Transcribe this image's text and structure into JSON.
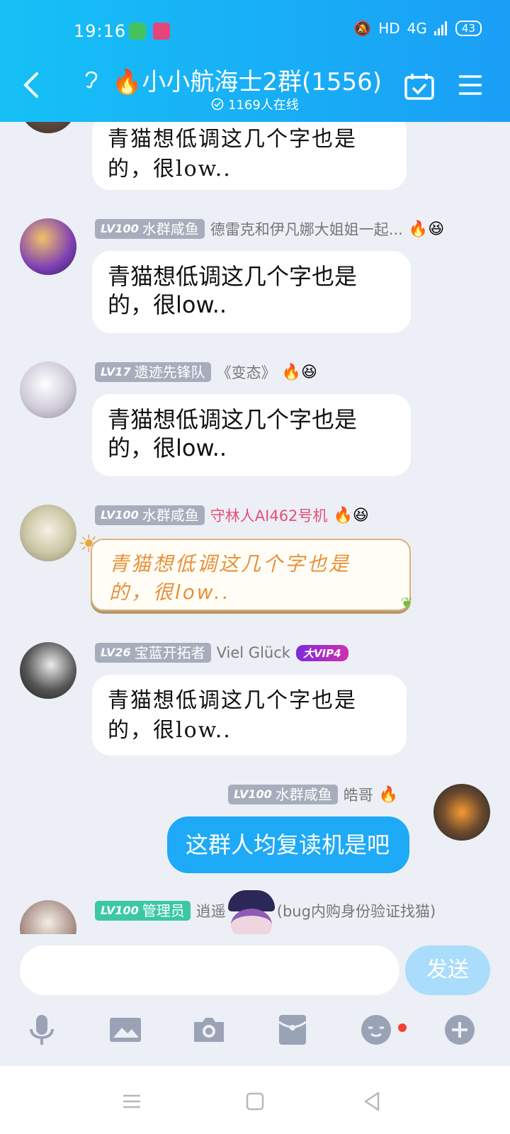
{
  "status": {
    "time": "19:16",
    "network": "HD",
    "signal": "4G",
    "battery": "43"
  },
  "header": {
    "title": "小小航海士2群(1556)",
    "online": "1169人在线",
    "flame": "🔥"
  },
  "messages": [
    {
      "text": "青猫想低调这几个字也是的，很low.."
    },
    {
      "level": "LV100",
      "title": "水群咸鱼",
      "nick": "德雷克和伊凡娜大姐姐一起...",
      "emojis": "🔥😆",
      "text": "青猫想低调这几个字也是的，很low.."
    },
    {
      "level": "LV17",
      "title": "遗迹先锋队",
      "nick": "《变态》",
      "emojis": "🔥😆",
      "text": "青猫想低调这几个字也是的，很low.."
    },
    {
      "level": "LV100",
      "title": "水群咸鱼",
      "nick": "守林人AI462号机",
      "emojis": "🔥😆",
      "text": "青猫想低调这几个字也是的，很low.."
    },
    {
      "level": "LV26",
      "title": "宝蓝开拓者",
      "nick": "Viel Glück",
      "vip": "大VIP4",
      "text": "青猫想低调这几个字也是的，很low.."
    },
    {
      "level": "LV100",
      "title": "水群咸鱼",
      "nick": "皓哥",
      "emojis": "🔥",
      "text": "这群人均复读机是吧"
    },
    {
      "level": "LV100",
      "title": "管理员",
      "nick": "逍遥",
      "nick2": "(bug内购身份验证找猫)"
    }
  ],
  "composer": {
    "send_label": "发送"
  },
  "colors": {
    "header": "#16c0f6",
    "self_bubble": "#1eaaf6",
    "send_disabled": "#a9ddfb"
  }
}
